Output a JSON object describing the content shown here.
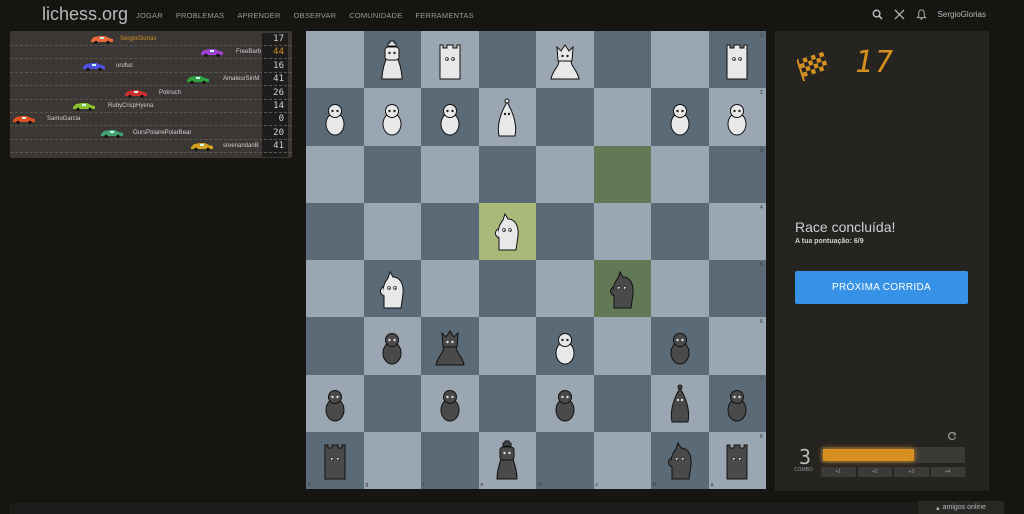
{
  "header": {
    "logo": "lichess.org",
    "nav": [
      "JOGAR",
      "PROBLEMAS",
      "APRENDER",
      "OBSERVAR",
      "COMUNIDADE",
      "FERRAMENTAS"
    ],
    "username": "SergioGlorias"
  },
  "race": {
    "players": [
      {
        "name": "SergioGlorias",
        "score": "17",
        "color": "#e86a3a",
        "highlight": true
      },
      {
        "name": "FreeBarb",
        "score": "44",
        "color": "#a040d0"
      },
      {
        "name": "urufuc",
        "score": "16",
        "color": "#5050e0"
      },
      {
        "name": "AmateurSinM",
        "score": "41",
        "color": "#30a040"
      },
      {
        "name": "Pokruch",
        "score": "26",
        "color": "#d03030"
      },
      {
        "name": "RubyCrispHyena",
        "score": "14",
        "color": "#8ac030"
      },
      {
        "name": "SamuGarcia",
        "score": "0",
        "color": "#e05020"
      },
      {
        "name": "OursPolairePolarBear",
        "score": "20",
        "color": "#40a070"
      },
      {
        "name": "sreenandanB",
        "score": "41",
        "color": "#d0a020"
      }
    ]
  },
  "board": {
    "files": [
      "h",
      "g",
      "f",
      "e",
      "d",
      "c",
      "b",
      "a"
    ],
    "ranks": [
      "1",
      "2",
      "3",
      "4",
      "5",
      "6",
      "7",
      "8"
    ]
  },
  "panel": {
    "score": "17",
    "title": "Race concluída!",
    "your_score": "A tua pontuação: 6/9",
    "next_button": "PRÓXIMA CORRIDA",
    "combo": "3",
    "combo_label": "COMBO",
    "combo_progress_percent": 65,
    "combo_steps": [
      "+1",
      "+2",
      "+3",
      "+4"
    ],
    "accent": "#d59020",
    "button_color": "#3692e7"
  },
  "footer": {
    "friends": "amigos online"
  }
}
